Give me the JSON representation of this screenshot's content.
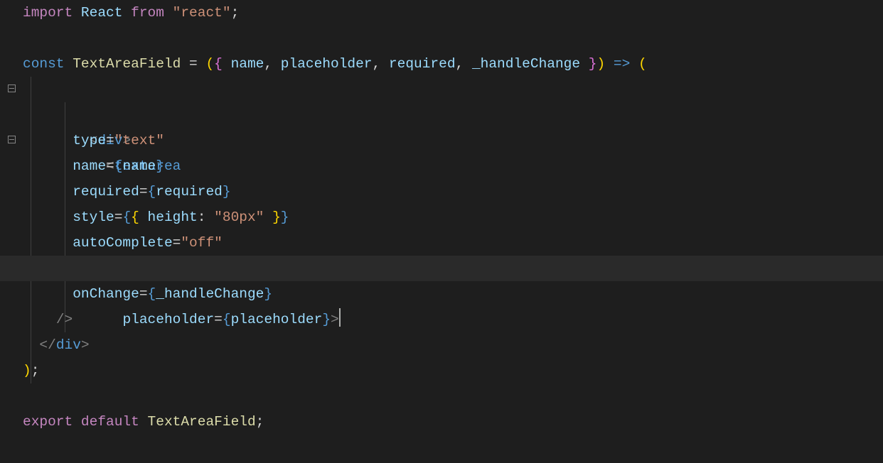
{
  "code": {
    "l1": {
      "kw_import": "import",
      "var_react": "React",
      "kw_from": "from",
      "str_react": "\"react\"",
      "semi": ";"
    },
    "l2": "",
    "l3": {
      "kw_const": "const",
      "fn_name": "TextAreaField",
      "eq": " = ",
      "lp": "(",
      "lb": "{ ",
      "p1": "name",
      "c": ", ",
      "p2": "placeholder",
      "p3": "required",
      "p4": "_handleChange",
      "rb": " }",
      "rp": ")",
      "arrow": " => ",
      "lp2": "("
    },
    "l4": {
      "lt": "<",
      "tag": "div",
      "gt": ">"
    },
    "l5": {
      "lt": "<",
      "tag": "textarea"
    },
    "l6": {
      "attr": "type",
      "eq": "=",
      "val": "\"text\""
    },
    "l7": {
      "attr": "name",
      "eq": "=",
      "lb": "{",
      "var": "name",
      "rb": "}"
    },
    "l8": {
      "attr": "required",
      "eq": "=",
      "lb": "{",
      "var": "required",
      "rb": "}"
    },
    "l9": {
      "attr": "style",
      "eq": "=",
      "lb": "{",
      "lb2": "{ ",
      "key": "height",
      "colon": ": ",
      "val": "\"80px\"",
      "rb2": " }",
      "rb": "}"
    },
    "l10": {
      "attr": "autoComplete",
      "eq": "=",
      "val": "\"off\""
    },
    "l11": {
      "attr": "placeholder",
      "eq": "=",
      "lb": "{",
      "var": "placeholder",
      "rb": "}",
      "gt": ">"
    },
    "l12": {
      "attr": "onChange",
      "eq": "=",
      "lb": "{",
      "var": "_handleChange",
      "rb": "}"
    },
    "l13": {
      "close": "/>"
    },
    "l14": {
      "lt": "</",
      "tag": "div",
      "gt": ">"
    },
    "l15": {
      "rp": ")",
      "semi": ";"
    },
    "l16": "",
    "l17": {
      "kw_export": "export",
      "kw_default": "default",
      "fn_name": "TextAreaField",
      "semi": ";"
    }
  }
}
